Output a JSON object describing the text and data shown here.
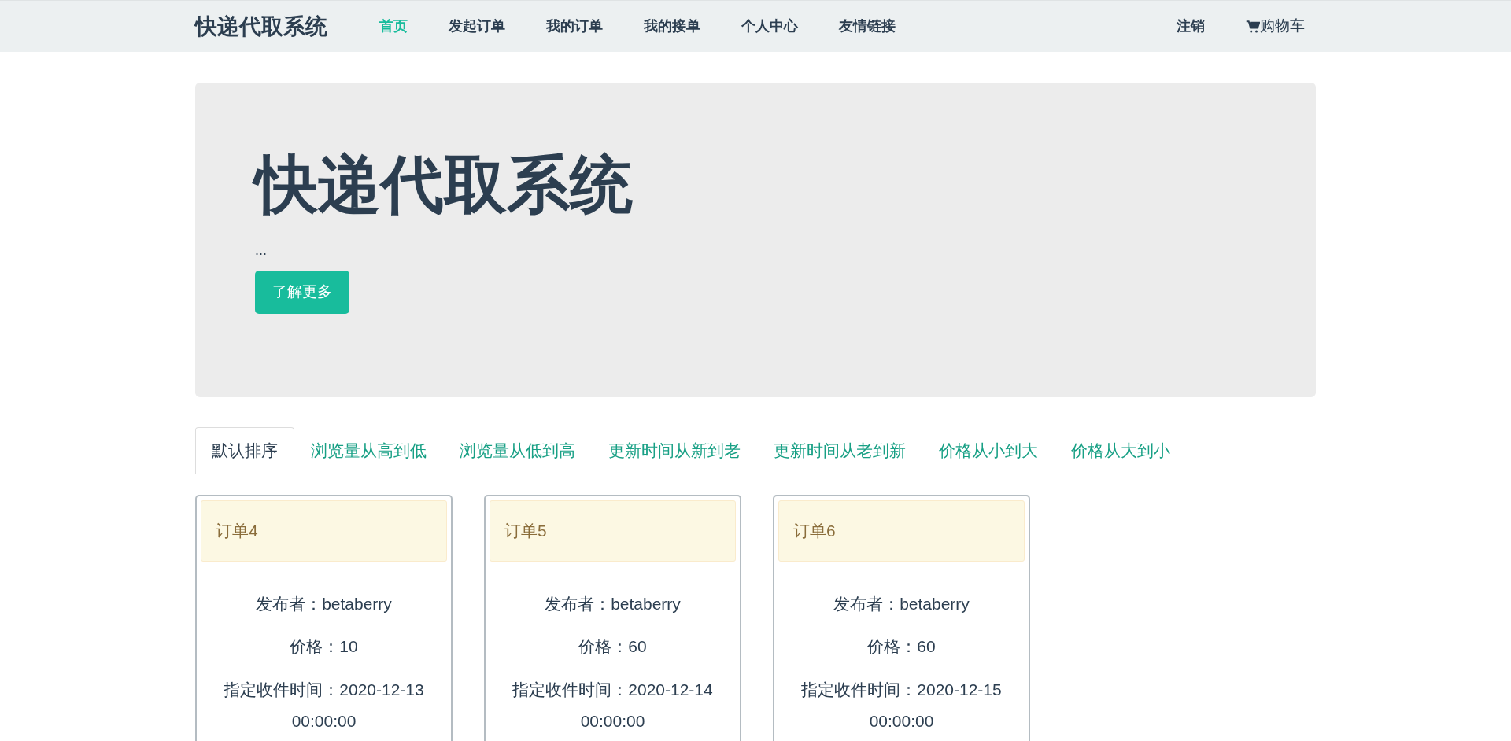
{
  "navbar": {
    "brand": "快递代取系统",
    "items": [
      {
        "label": "首页",
        "selected": true
      },
      {
        "label": "发起订单",
        "selected": false
      },
      {
        "label": "我的订单",
        "selected": false
      },
      {
        "label": "我的接单",
        "selected": false
      },
      {
        "label": "个人中心",
        "selected": false
      },
      {
        "label": "友情链接",
        "selected": false
      }
    ],
    "logout": "注销",
    "cart": "购物车"
  },
  "jumbotron": {
    "title": "快递代取系统",
    "text": "...",
    "button": "了解更多"
  },
  "sort_tabs": [
    {
      "label": "默认排序",
      "selected": true
    },
    {
      "label": "浏览量从高到低",
      "selected": false
    },
    {
      "label": "浏览量从低到高",
      "selected": false
    },
    {
      "label": "更新时间从新到老",
      "selected": false
    },
    {
      "label": "更新时间从老到新",
      "selected": false
    },
    {
      "label": "价格从小到大",
      "selected": false
    },
    {
      "label": "价格从大到小",
      "selected": false
    }
  ],
  "orders": [
    {
      "title": "订单4",
      "publisher": "发布者：betaberry",
      "price": "价格：10",
      "time": "指定收件时间：2020-12-13 00:00:00"
    },
    {
      "title": "订单5",
      "publisher": "发布者：betaberry",
      "price": "价格：60",
      "time": "指定收件时间：2020-12-14 00:00:00"
    },
    {
      "title": "订单6",
      "publisher": "发布者：betaberry",
      "price": "价格：60",
      "time": "指定收件时间：2020-12-15 00:00:00"
    }
  ]
}
